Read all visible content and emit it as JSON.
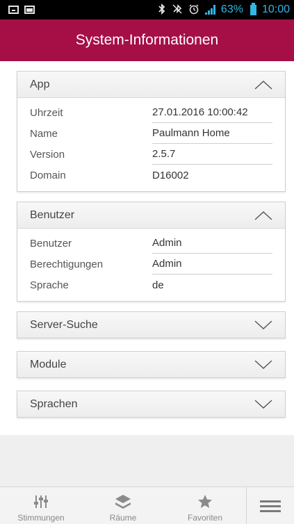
{
  "statusbar": {
    "battery": "63%",
    "time": "10:00",
    "icons": [
      "screen-icon",
      "image-icon",
      "bluetooth-icon",
      "mute-icon",
      "alarm-icon",
      "signal-icon",
      "battery-icon"
    ]
  },
  "header": {
    "title": "System-Informationen"
  },
  "colors": {
    "accent": "#a50f45",
    "statusbar_text": "#33b5e5"
  },
  "panels": {
    "app": {
      "title": "App",
      "rows": [
        {
          "label": "Uhrzeit",
          "value": "27.01.2016 10:00:42"
        },
        {
          "label": "Name",
          "value": "Paulmann Home"
        },
        {
          "label": "Version",
          "value": "2.5.7"
        },
        {
          "label": "Domain",
          "value": "D16002"
        }
      ]
    },
    "benutzer": {
      "title": "Benutzer",
      "rows": [
        {
          "label": "Benutzer",
          "value": "Admin"
        },
        {
          "label": "Berechtigungen",
          "value": "Admin"
        },
        {
          "label": "Sprache",
          "value": "de"
        }
      ]
    },
    "server_suche": {
      "title": "Server-Suche"
    },
    "module": {
      "title": "Module"
    },
    "sprachen": {
      "title": "Sprachen"
    }
  },
  "bottomnav": {
    "items": [
      {
        "label": "Stimmungen",
        "icon": "sliders-icon"
      },
      {
        "label": "Räume",
        "icon": "rooms-icon"
      },
      {
        "label": "Favoriten",
        "icon": "star-icon"
      }
    ],
    "menu_icon": "hamburger-menu-icon"
  }
}
